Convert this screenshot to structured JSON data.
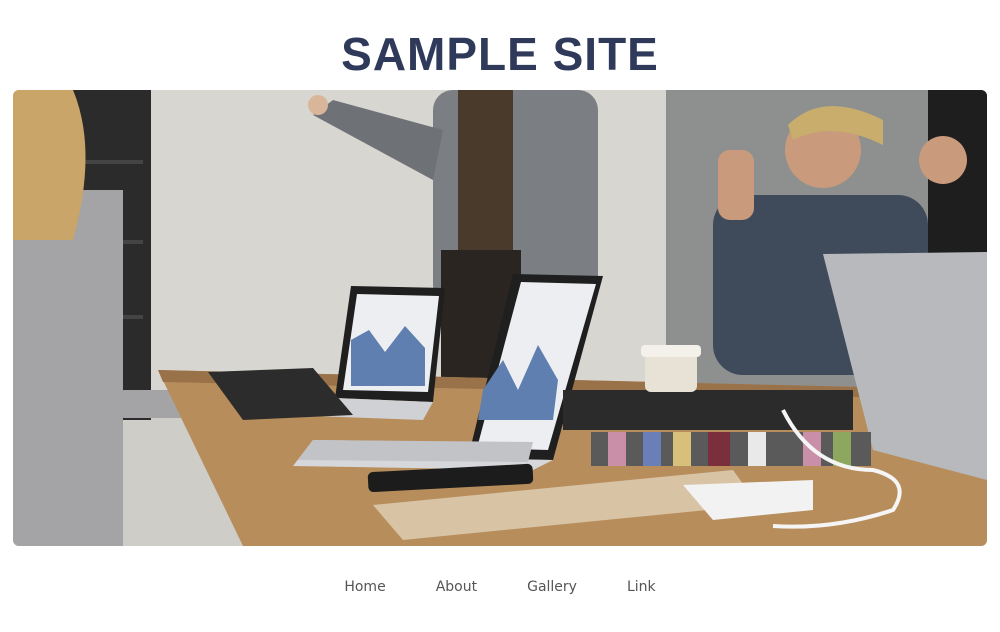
{
  "header": {
    "title": "SAMPLE SITE",
    "title_color": "#2f3a5a"
  },
  "hero": {
    "image_alt": "Team meeting in an office with laptops showing charts",
    "icon": "photo-image"
  },
  "nav": {
    "items": [
      {
        "label": "Home"
      },
      {
        "label": "About"
      },
      {
        "label": "Gallery"
      },
      {
        "label": "Link"
      }
    ]
  }
}
